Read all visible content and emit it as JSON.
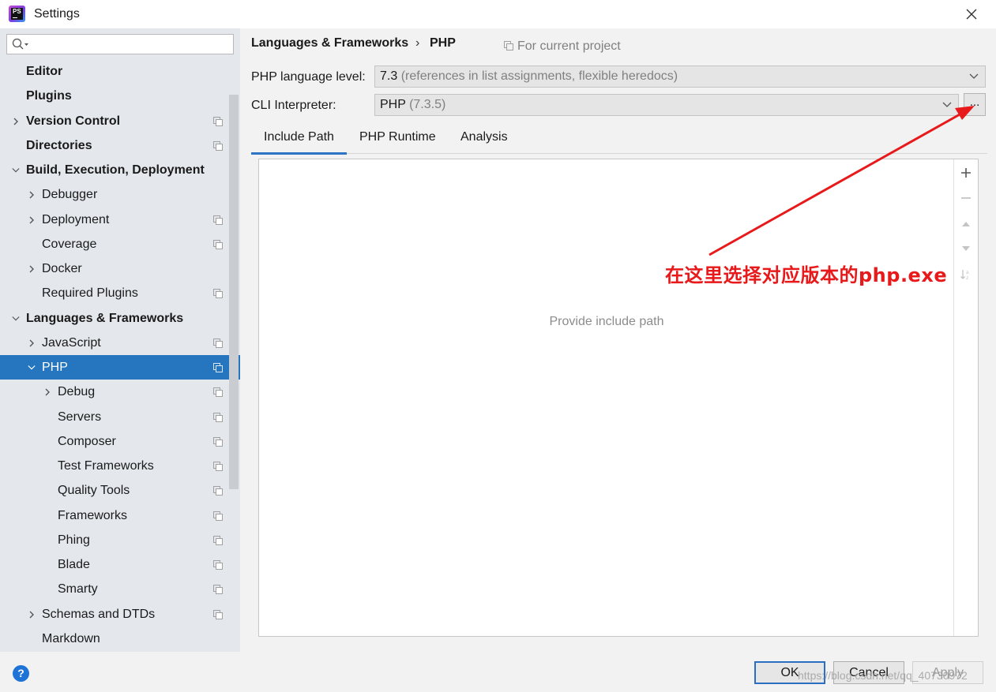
{
  "window": {
    "title": "Settings",
    "app_icon_text": "PS"
  },
  "search": {
    "placeholder": ""
  },
  "sidebar": {
    "items": [
      {
        "label": "Editor"
      },
      {
        "label": "Plugins"
      },
      {
        "label": "Version Control"
      },
      {
        "label": "Directories"
      },
      {
        "label": "Build, Execution, Deployment"
      },
      {
        "label": "Debugger"
      },
      {
        "label": "Deployment"
      },
      {
        "label": "Coverage"
      },
      {
        "label": "Docker"
      },
      {
        "label": "Required Plugins"
      },
      {
        "label": "Languages & Frameworks"
      },
      {
        "label": "JavaScript"
      },
      {
        "label": "PHP"
      },
      {
        "label": "Debug"
      },
      {
        "label": "Servers"
      },
      {
        "label": "Composer"
      },
      {
        "label": "Test Frameworks"
      },
      {
        "label": "Quality Tools"
      },
      {
        "label": "Frameworks"
      },
      {
        "label": "Phing"
      },
      {
        "label": "Blade"
      },
      {
        "label": "Smarty"
      },
      {
        "label": "Schemas and DTDs"
      },
      {
        "label": "Markdown"
      }
    ]
  },
  "breadcrumb": {
    "parent": "Languages & Frameworks",
    "separator": "›",
    "current": "PHP",
    "scope": "For current project"
  },
  "php_language_level": {
    "label": "PHP language level:",
    "value": "7.3",
    "description": "(references in list assignments, flexible heredocs)"
  },
  "cli_interpreter": {
    "label": "CLI Interpreter:",
    "value": "PHP",
    "version": "(7.3.5)",
    "browse_label": "..."
  },
  "tabs": [
    {
      "label": "Include Path"
    },
    {
      "label": "PHP Runtime"
    },
    {
      "label": "Analysis"
    }
  ],
  "include_path": {
    "empty_text": "Provide include path"
  },
  "annotation": {
    "text": "在这里选择对应版本的php.exe",
    "color": "#e8191a"
  },
  "buttons": {
    "ok": "OK",
    "cancel": "Cancel",
    "apply": "Apply",
    "help": "?"
  },
  "watermark": "https://blog.csdn.net/qq_40730972",
  "colors": {
    "selection": "#2675bf",
    "accent": "#2d74c4",
    "annotation": "#e8191a"
  }
}
